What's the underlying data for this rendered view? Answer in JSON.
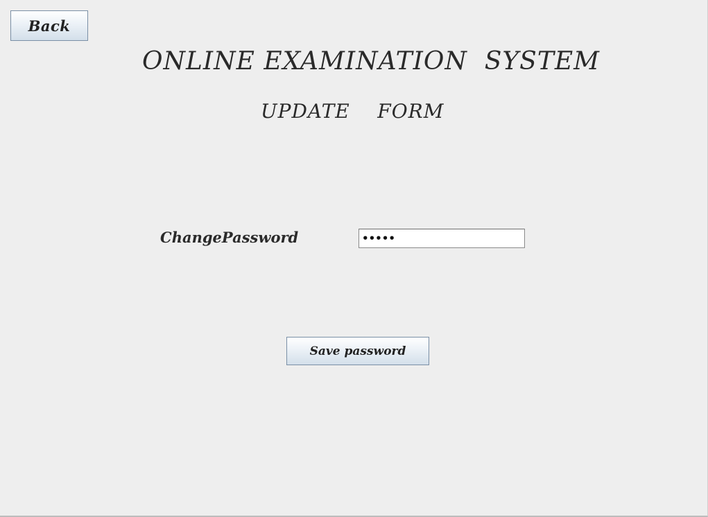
{
  "header": {
    "back_label": "Back",
    "title": "ONLINE EXAMINATION  SYSTEM",
    "subtitle": "UPDATE    FORM"
  },
  "form": {
    "password_label": "ChangePassword",
    "password_value": "•••••",
    "save_label": "Save password"
  }
}
